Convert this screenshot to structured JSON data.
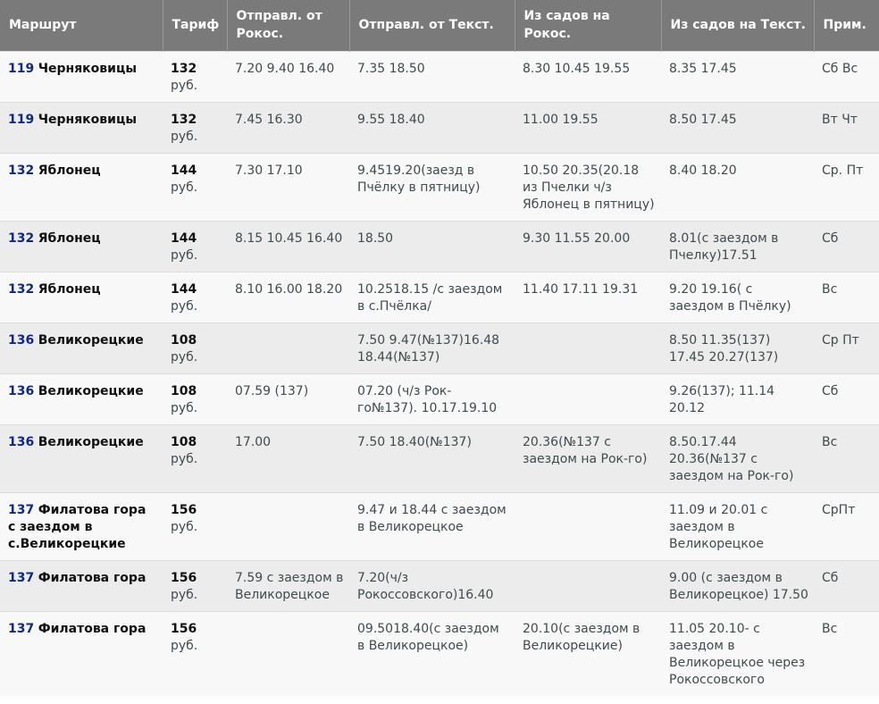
{
  "headers": {
    "route": "Маршрут",
    "fare": "Тариф",
    "dep_rokos": "Отправл. от Рокос.",
    "dep_tekst": "Отправл. от Текст.",
    "from_gardens_rokos": "Из садов на Рокос.",
    "from_gardens_tekst": "Из садов на Текст.",
    "note": "Прим."
  },
  "rows": [
    {
      "num": "119",
      "name": "Черняковицы",
      "fare": "132",
      "currency": "руб.",
      "dep_rokos": "7.20 9.40 16.40",
      "dep_tekst": "7.35 18.50",
      "ret_rokos": "8.30 10.45 19.55",
      "ret_tekst": "8.35 17.45",
      "note": "Сб Вс"
    },
    {
      "num": "119",
      "name": "Черняковицы",
      "fare": "132",
      "currency": "руб.",
      "dep_rokos": "7.45 16.30",
      "dep_tekst": "9.55 18.40",
      "ret_rokos": "11.00 19.55",
      "ret_tekst": "8.50 17.45",
      "note": "Вт Чт"
    },
    {
      "num": "132",
      "name": "Яблонец",
      "fare": "144",
      "currency": "руб.",
      "dep_rokos": "7.30 17.10",
      "dep_tekst": "9.4519.20(заезд в Пчёлку в пятницу)",
      "ret_rokos": "10.50 20.35(20.18 из Пчелки ч/з Яблонец в пятницу)",
      "ret_tekst": "8.40 18.20",
      "note": "Ср. Пт"
    },
    {
      "num": "132",
      "name": "Яблонец",
      "fare": "144",
      "currency": "руб.",
      "dep_rokos": "8.15 10.45 16.40",
      "dep_tekst": "18.50",
      "ret_rokos": "9.30 11.55 20.00",
      "ret_tekst": "8.01(с заездом в Пчелку)17.51",
      "note": "Сб"
    },
    {
      "num": "132",
      "name": "Яблонец",
      "fare": "144",
      "currency": "руб.",
      "dep_rokos": "8.10 16.00 18.20",
      "dep_tekst": "10.2518.15 /с заездом в с.Пчёлка/",
      "ret_rokos": "11.40 17.11 19.31",
      "ret_tekst": "9.20 19.16( с заездом в Пчёлку)",
      "note": "Вс"
    },
    {
      "num": "136",
      "name": "Великорецкие",
      "fare": "108",
      "currency": "руб.",
      "dep_rokos": "",
      "dep_tekst": "7.50 9.47(№137)16.48 18.44(№137)",
      "ret_rokos": "",
      "ret_tekst": "8.50 11.35(137) 17.45 20.27(137)",
      "note": "Ср Пт"
    },
    {
      "num": "136",
      "name": "Великорецкие",
      "fare": "108",
      "currency": "руб.",
      "dep_rokos": "07.59 (137)",
      "dep_tekst": "07.20 (ч/з Рок-го№137). 10.17.19.10",
      "ret_rokos": "",
      "ret_tekst": "9.26(137); 11.14 20.12",
      "note": "Сб"
    },
    {
      "num": "136",
      "name": "Великорецкие",
      "fare": "108",
      "currency": "руб.",
      "dep_rokos": "17.00",
      "dep_tekst": "7.50 18.40(№137)",
      "ret_rokos": "20.36(№137 с заездом на Рок-го)",
      "ret_tekst": "8.50.17.44 20.36(№137 с заездом на Рок-го)",
      "note": "Вс"
    },
    {
      "num": "137",
      "name": "Филатова гора с заездом в с.Великорецкие",
      "fare": "156",
      "currency": "руб.",
      "dep_rokos": "",
      "dep_tekst": "9.47 и 18.44 с заездом в Великорецкое",
      "ret_rokos": "",
      "ret_tekst": "11.09 и 20.01 с заездом в Великорецкое",
      "note": "СрПт"
    },
    {
      "num": "137",
      "name": "Филатова гора",
      "fare": "156",
      "currency": "руб.",
      "dep_rokos": "7.59 с заездом в Великорецкое",
      "dep_tekst": "7.20(ч/з Рокоссовского)16.40",
      "ret_rokos": "",
      "ret_tekst": "9.00 (с заездом в Великорецкое) 17.50",
      "note": "Сб"
    },
    {
      "num": "137",
      "name": "Филатова гора",
      "fare": "156",
      "currency": "руб.",
      "dep_rokos": "",
      "dep_tekst": "09.5018.40(с заездом в Великорецкое)",
      "ret_rokos": "20.10(с заездом в Великорецкие)",
      "ret_tekst": "11.05 20.10- с заездом в Великорецкое через Рокоссовского",
      "note": "Вс"
    }
  ]
}
